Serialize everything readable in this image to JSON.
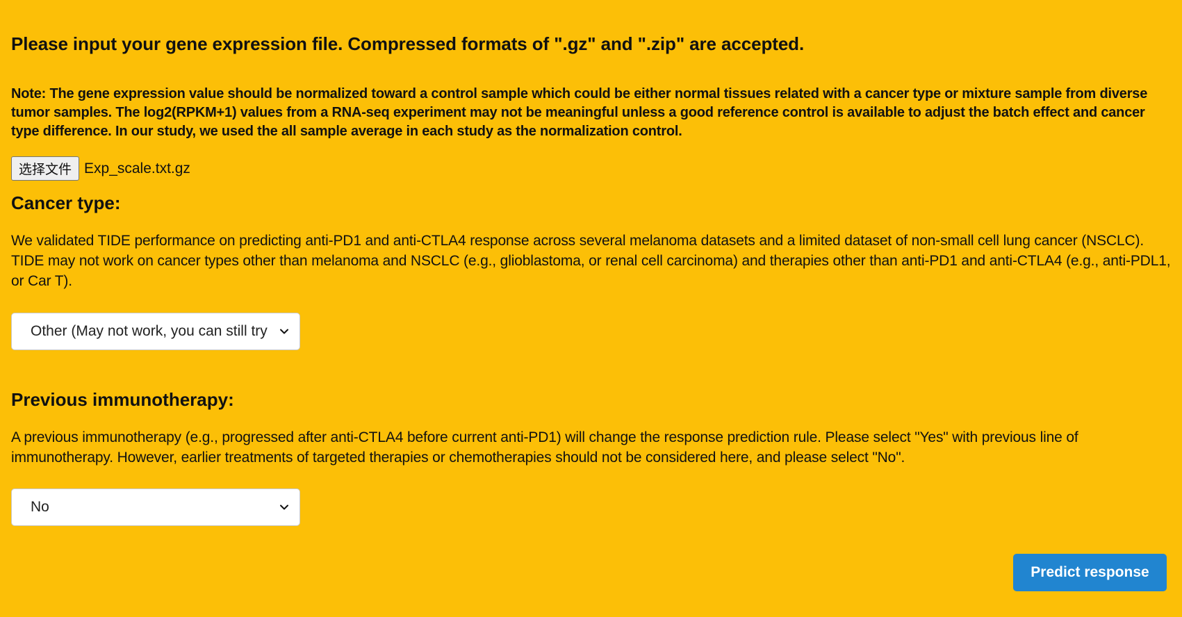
{
  "upload": {
    "heading": "Please input your gene expression file. Compressed formats of \".gz\" and \".zip\" are accepted.",
    "note": "Note: The gene expression value should be normalized toward a control sample which could be either normal tissues related with a cancer type or mixture sample from diverse tumor samples. The log2(RPKM+1) values from a RNA-seq experiment may not be meaningful unless a good reference control is available to adjust the batch effect and cancer type difference. In our study, we used the all sample average in each study as the normalization control.",
    "choose_file_label": "选择文件",
    "file_name": "Exp_scale.txt.gz"
  },
  "cancer_type": {
    "heading": "Cancer type:",
    "description": "We validated TIDE performance on predicting anti-PD1 and anti-CTLA4 response across several melanoma datasets and a limited dataset of non-small cell lung cancer (NSCLC). TIDE may not work on cancer types other than melanoma and NSCLC (e.g., glioblastoma, or renal cell carcinoma) and therapies other than anti-PD1 and anti-CTLA4 (e.g., anti-PDL1, or Car T).",
    "selected": "Other (May not work, you can still try"
  },
  "immunotherapy": {
    "heading": "Previous immunotherapy:",
    "description": "A previous immunotherapy (e.g., progressed after anti-CTLA4 before current anti-PD1) will change the response prediction rule. Please select \"Yes\" with previous line of immunotherapy. However, earlier treatments of targeted therapies or chemotherapies should not be considered here, and please select \"No\".",
    "selected": "No"
  },
  "actions": {
    "predict_label": "Predict response"
  },
  "icons": {
    "select_arrow": "chevron-down-icon"
  },
  "colors": {
    "background": "#FCBF07",
    "primary_button": "#2185D0"
  }
}
